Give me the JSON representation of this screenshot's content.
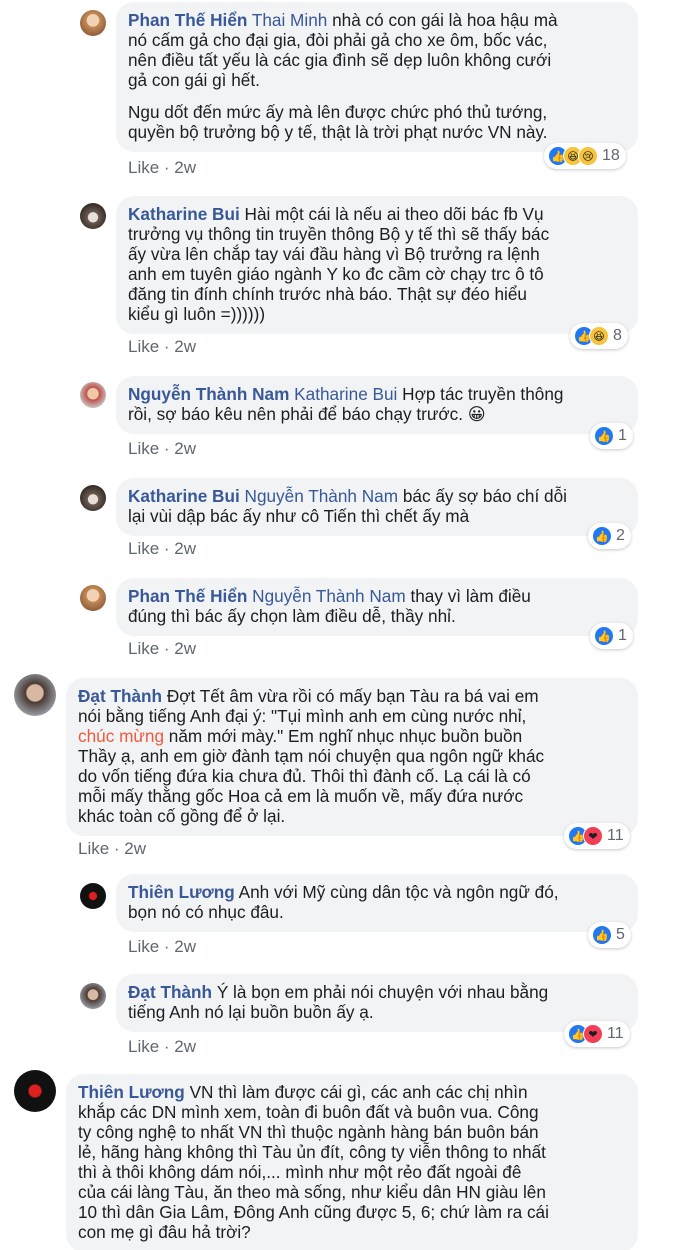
{
  "colors": {
    "name": "#385898",
    "meta": "#606770",
    "bubble": "#f2f3f5",
    "like": "#2078f4",
    "love": "#f33e58",
    "emoji": "#f7c33b",
    "highlight": "#f05a3c"
  },
  "comments": [
    {
      "author": "Phan Thế Hiển",
      "tag": "Thai Minh",
      "paragraphs": [
        [
          "nhà có con gái là hoa hậu mà",
          "nó cấm gả cho đại gia, đòi phải gả cho xe ôm, bốc vác,",
          "nên điều tất yếu là các gia đình sẽ dẹp luôn không cưới",
          "gả con gái gì hết."
        ],
        [
          "Ngu dốt đến mức ấy mà lên được chức phó thủ tướng,",
          "quyền bộ trưởng bộ y tế, thật là trời phạt nước VN này."
        ]
      ],
      "like_label": "Like",
      "time": "2w",
      "reactions": [
        "like",
        "haha",
        "sad"
      ],
      "reaction_count": "18"
    },
    {
      "author": "Katharine Bui",
      "tag": "",
      "paragraphs": [
        [
          "Hài một cái là nếu ai theo dõi bác fb Vụ",
          "trưởng vụ thông tin truyền thông Bộ y tế thì sẽ thấy bác",
          "ấy vừa lên chắp tay vái đầu hàng vì Bộ trưởng ra lệnh",
          "anh em tuyên giáo ngành Y ko đc cầm cờ chạy trc ô tô",
          "đăng tin đính chính trước nhà báo. Thật sự đéo hiểu",
          "kiểu gì luôn =))))))"
        ]
      ],
      "like_label": "Like",
      "time": "2w",
      "reactions": [
        "like",
        "haha"
      ],
      "reaction_count": "8"
    },
    {
      "author": "Nguyễn Thành Nam",
      "tag": "Katharine Bui",
      "paragraphs": [
        [
          "Hợp tác truyền thông",
          "rồi, sợ báo kêu nên phải để báo chạy trước. 😀"
        ]
      ],
      "like_label": "Like",
      "time": "2w",
      "reactions": [
        "like"
      ],
      "reaction_count": "1"
    },
    {
      "author": "Katharine Bui",
      "tag": "Nguyễn Thành Nam",
      "paragraphs": [
        [
          "bác ấy sợ báo chí dỗi",
          "lại vùi dập bác ấy như cô Tiến thì chết ấy mà"
        ]
      ],
      "like_label": "Like",
      "time": "2w",
      "reactions": [
        "like"
      ],
      "reaction_count": "2"
    },
    {
      "author": "Phan Thế Hiển",
      "tag": "Nguyễn Thành Nam",
      "paragraphs": [
        [
          "thay vì làm điều",
          "đúng thì bác ấy chọn làm điều dễ, thầy nhỉ."
        ]
      ],
      "like_label": "Like",
      "time": "2w",
      "reactions": [
        "like"
      ],
      "reaction_count": "1"
    },
    {
      "author": "Đạt Thành",
      "tag": "",
      "line1": "Đợt Tết âm vừa rồi có mấy bạn Tàu ra bá vai em",
      "line2": "nói bằng tiếng Anh đại ý: \"Tụi mình anh em cùng nước nhỉ,",
      "highlight": "chúc mừng",
      "line3_rest": " năm mới mày.\" Em nghĩ nhục nhục buồn buồn",
      "rest": [
        "Thầy ạ, anh em giờ đành tạm nói chuyện qua ngôn ngữ khác",
        "do vốn tiếng đứa kia chưa đủ. Thôi thì đành cố. Lạ cái là có",
        "mỗi mấy thằng gốc Hoa cả em là muốn về, mấy đứa nước",
        "khác toàn cố gồng để ở lại."
      ],
      "like_label": "Like",
      "time": "2w",
      "reactions": [
        "like",
        "love"
      ],
      "reaction_count": "11"
    },
    {
      "author": "Thiên Lương",
      "tag": "",
      "paragraphs": [
        [
          "Anh với Mỹ cùng dân tộc và ngôn ngữ đó,",
          "bọn nó có nhục đâu."
        ]
      ],
      "like_label": "Like",
      "time": "2w",
      "reactions": [
        "like"
      ],
      "reaction_count": "5"
    },
    {
      "author": "Đạt Thành",
      "tag": "",
      "paragraphs": [
        [
          "Ý là bọn em phải nói chuyện với nhau bằng",
          "tiếng Anh nó lại buồn buồn ấy ạ."
        ]
      ],
      "like_label": "Like",
      "time": "2w",
      "reactions": [
        "like",
        "love"
      ],
      "reaction_count": "11"
    },
    {
      "author": "Thiên Lương",
      "tag": "",
      "paragraphs": [
        [
          "VN thì làm được cái gì, các anh các chị nhìn",
          "khắp các DN mình xem, toàn đi buôn đất và buôn vua. Công",
          "ty công nghệ to nhất VN thì thuộc ngành hàng bán buôn bán",
          "lẻ, hãng hàng không thì Tàu ủn đít, công ty viễn thông to nhất",
          "thì à thôi không dám nói,... mình như một rẻo đất ngoài đê",
          "của cái làng Tàu, ăn theo mà sống, như kiểu dân HN giàu lên",
          "10 thì dân Gia Lâm, Đông Anh cũng được 5, 6; chứ làm ra cái",
          "con mẹ gì đâu hả trời?"
        ]
      ]
    }
  ]
}
